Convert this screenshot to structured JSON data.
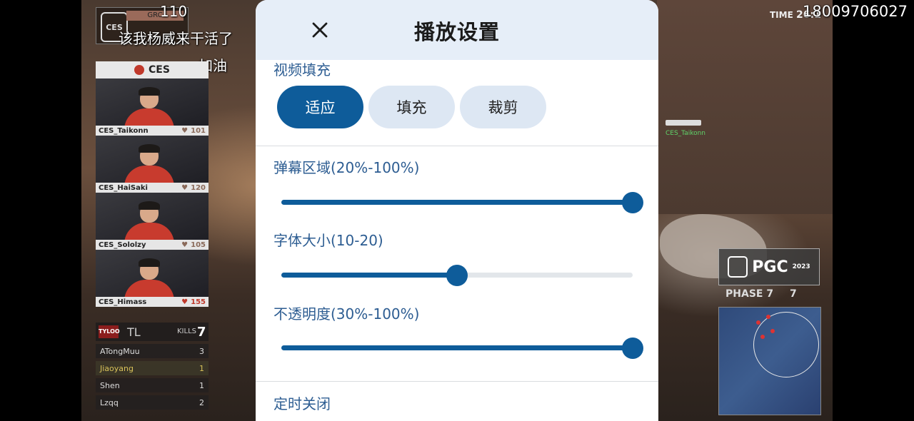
{
  "overlay": {
    "danmaku": [
      {
        "text": "110"
      },
      {
        "text": "该我杨威来干活了"
      },
      {
        "text": "加油"
      }
    ],
    "top_number": "18009706027",
    "logo_tag": "GRC",
    "logo_mark": "CES",
    "time_label": "TIME",
    "time_value": "26:1",
    "gun_tag": "CES_Taikonn"
  },
  "team_panel": {
    "team_name": "CES",
    "players": [
      {
        "name": "CES_Taikonn",
        "hp": "101"
      },
      {
        "name": "CES_HaiSaki",
        "hp": "120"
      },
      {
        "name": "CES_Sololzy",
        "hp": "105"
      },
      {
        "name": "CES_Himass",
        "hp": "155"
      }
    ]
  },
  "kills_board": {
    "badge": "TYLOO",
    "team": "TL",
    "kills_label": "KILLS",
    "kills_value": "7",
    "rows": [
      {
        "name": "ATongMuu",
        "kills": "3"
      },
      {
        "name": "Jiaoyang",
        "kills": "1"
      },
      {
        "name": "Shen",
        "kills": "1"
      },
      {
        "name": "Lzqq",
        "kills": "2"
      }
    ]
  },
  "hud": {
    "pgc_label": "PGC",
    "pgc_year": "2023",
    "phase_label": "PHASE 7",
    "phase_value": "7"
  },
  "settings": {
    "title": "播放设置",
    "video_fill": {
      "label": "视频填充",
      "options": [
        "适应",
        "填充",
        "裁剪"
      ],
      "selected": "适应"
    },
    "danmaku_area": {
      "label": "弹幕区域(20%-100%)",
      "value_fraction": 1.0
    },
    "font_size": {
      "label": "字体大小(10-20)",
      "value_fraction": 0.5
    },
    "opacity": {
      "label": "不透明度(30%-100%)",
      "value_fraction": 1.0
    },
    "timer_off": {
      "label": "定时关闭"
    }
  },
  "colors": {
    "accent": "#0e5c9a",
    "pill_bg": "#dde7f3",
    "header_bg": "#e6eef8",
    "label": "#2d5d92"
  }
}
